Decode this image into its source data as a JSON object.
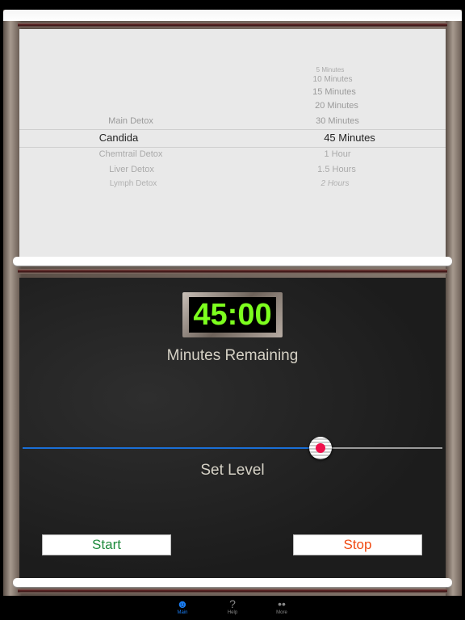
{
  "picker": {
    "programs": [
      {
        "label": "Main Detox",
        "state": "near"
      },
      {
        "label": "Candida",
        "state": "selected"
      },
      {
        "label": "Chemtrail Detox",
        "state": "near"
      },
      {
        "label": "Liver Detox",
        "state": "far"
      },
      {
        "label": "Lymph Detox",
        "state": "farther"
      }
    ],
    "durations": [
      {
        "label": "5 Minutes"
      },
      {
        "label": "10 Minutes"
      },
      {
        "label": "15 Minutes"
      },
      {
        "label": "20 Minutes"
      },
      {
        "label": "30 Minutes"
      },
      {
        "label": "45 Minutes",
        "state": "selected"
      },
      {
        "label": "1 Hour"
      },
      {
        "label": "1.5 Hours"
      },
      {
        "label": "2 Hours"
      }
    ]
  },
  "timer": {
    "display": "45:00",
    "caption": "Minutes Remaining",
    "color": "#7dff1e"
  },
  "level": {
    "label": "Set Level",
    "value_fraction": 0.71,
    "fill_color": "#1a6fd6",
    "thumb_color": "#f0104c"
  },
  "buttons": {
    "start": "Start",
    "stop": "Stop",
    "start_color": "#1e8a3c",
    "stop_color": "#f04a12"
  },
  "tabbar": {
    "items": [
      {
        "label": "Main",
        "icon": "skull-icon",
        "active": true
      },
      {
        "label": "Help",
        "icon": "question-icon",
        "active": false
      },
      {
        "label": "More",
        "icon": "ellipsis-icon",
        "active": false
      }
    ],
    "active_color": "#1a7cf0"
  }
}
